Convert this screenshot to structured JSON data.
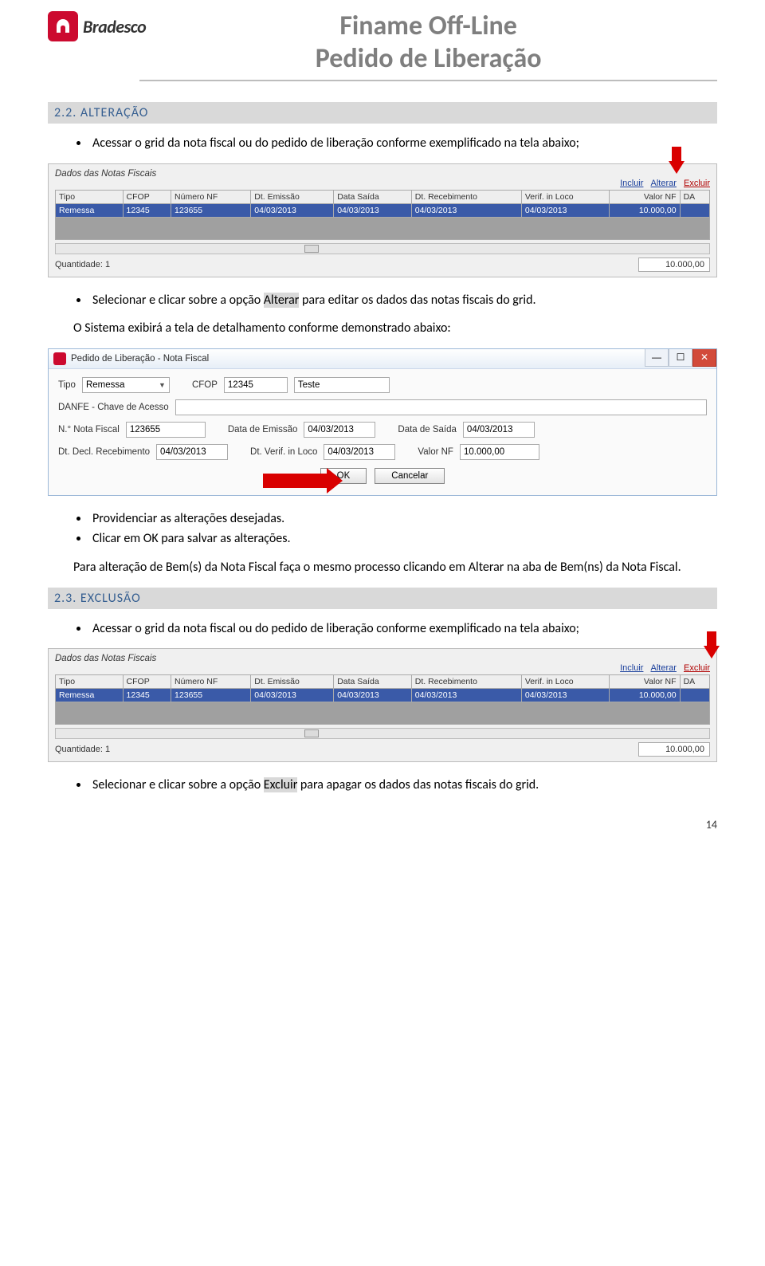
{
  "header": {
    "brand": "Bradesco",
    "title1": "Finame Off-Line",
    "title2": "Pedido de Liberação"
  },
  "sections": {
    "s22": {
      "heading": "2.2. ALTERAÇÃO",
      "bullet1": "Acessar o grid da nota fiscal ou do pedido de liberação conforme exemplificado na tela abaixo;",
      "bullet2a": "Selecionar e clicar sobre a opção ",
      "bullet2b": "Alterar",
      "bullet2c": " para editar os dados das notas fiscais do grid.",
      "para1": "O Sistema exibirá a tela de detalhamento conforme demonstrado abaixo:",
      "bullet3": "Providenciar as alterações desejadas.",
      "bullet4": "Clicar em OK para salvar as alterações.",
      "para2": "Para alteração de Bem(s) da Nota Fiscal faça o mesmo processo clicando em Alterar na aba de Bem(ns) da Nota Fiscal."
    },
    "s23": {
      "heading": "2.3. EXCLUSÃO",
      "bullet1": "Acessar o grid da nota fiscal ou do pedido de liberação conforme exemplificado na tela abaixo;",
      "bullet2a": "Selecionar e clicar sobre a opção ",
      "bullet2b": "Excluir",
      "bullet2c": " para apagar os dados das notas fiscais do grid."
    }
  },
  "grid_panel": {
    "title": "Dados das Notas Fiscais",
    "links": {
      "incluir": "Incluir",
      "alterar": "Alterar",
      "excluir": "Excluir"
    },
    "headers": [
      "Tipo",
      "CFOP",
      "Número NF",
      "Dt. Emissão",
      "Data Saída",
      "Dt. Recebimento",
      "Verif. in Loco",
      "Valor NF",
      "DA"
    ],
    "row": [
      "Remessa",
      "12345",
      "123655",
      "04/03/2013",
      "04/03/2013",
      "04/03/2013",
      "04/03/2013",
      "10.000,00",
      ""
    ],
    "qty_label": "Quantidade:",
    "qty_value": "1",
    "total": "10.000,00"
  },
  "dialog": {
    "title": "Pedido de Liberação - Nota Fiscal",
    "labels": {
      "tipo": "Tipo",
      "cfop": "CFOP",
      "danfe": "DANFE - Chave de Acesso",
      "nnota": "N.° Nota Fiscal",
      "dtemi": "Data de Emissão",
      "dtsai": "Data de Saída",
      "dtrec": "Dt. Decl. Recebimento",
      "dtver": "Dt. Verif. in Loco",
      "valor": "Valor NF"
    },
    "values": {
      "tipo": "Remessa",
      "cfop": "12345",
      "cfop_desc": "Teste",
      "nnota": "123655",
      "dtemi": "04/03/2013",
      "dtsai": "04/03/2013",
      "dtrec": "04/03/2013",
      "dtver": "04/03/2013",
      "valor": "10.000,00"
    },
    "buttons": {
      "ok": "OK",
      "cancel": "Cancelar"
    }
  },
  "page_number": "14"
}
